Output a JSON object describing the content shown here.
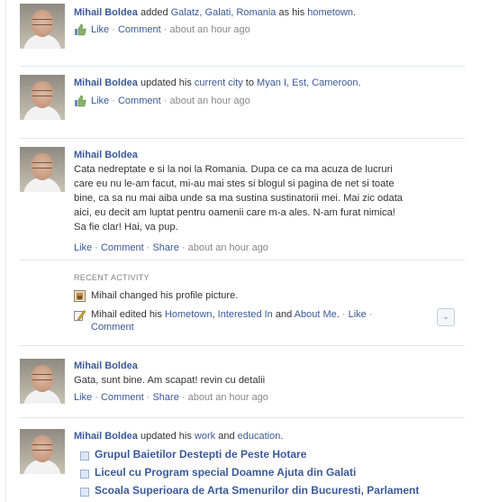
{
  "stories": {
    "s1": {
      "actor": "Mihail Boldea",
      "verb": "added",
      "place": "Galatz, Galati, Romania",
      "as_his": "as his",
      "target": "hometown",
      "end": ".",
      "like": "Like",
      "dot": "·",
      "comment": "Comment",
      "time": "about an hour ago"
    },
    "s2": {
      "actor": "Mihail Boldea",
      "updated_his": "updated his",
      "what": "current city",
      "to": "to",
      "place": "Myan I, Est, Cameroon",
      "end": ".",
      "like": "Like",
      "dot": "·",
      "comment": "Comment",
      "time": "about an hour ago"
    },
    "s3": {
      "actor": "Mihail Boldea",
      "lines": [
        "Cata nedreptate e si la noi la Romania. Dupa ce ca ma acuza de lucruri",
        "care eu nu le-am facut, mi-au mai stes si blogul si pagina de net si toate",
        "bine, ca sa nu mai aiba unde sa ma sustina sustinatorii mei. Mai zic odata",
        "aici, eu decit am luptat pentru oamenii care m-a ales. N-am furat nimica!",
        "Sa fie clar! Hai, va pup."
      ],
      "like": "Like",
      "dot": "·",
      "comment": "Comment",
      "share": "Share",
      "time": "about an hour ago"
    },
    "recent": {
      "heading": "RECENT ACTIVITY",
      "item1": "Mihail changed his profile picture.",
      "item2_pre": "Mihail edited his",
      "item2_a": "Hometown",
      "item2_comma": ",",
      "item2_b": "Interested In",
      "item2_and": "and",
      "item2_c": "About Me",
      "item2_end": ".",
      "dot": "·",
      "like": "Like",
      "comment": "Comment"
    },
    "s4": {
      "actor": "Mihail Boldea",
      "text": "Gata, sunt bine. Am scapat! revin cu detalii",
      "like": "Like",
      "dot": "·",
      "comment": "Comment",
      "share": "Share",
      "time": "about an hour ago"
    },
    "s5": {
      "actor": "Mihail Boldea",
      "updated_his": "updated his",
      "work": "work",
      "and": "and",
      "education": "education",
      "end": ".",
      "items": [
        "Grupul Baietilor Destepti de Peste Hotare",
        "Liceul cu Program special Doamne Ajuta din Galati",
        "Scoala Superioara de Arta Smenurilor din Bucuresti, Parlament"
      ]
    }
  },
  "colors": {
    "link": "#3b5998",
    "meta": "#888888",
    "separator": "#e4e7ee"
  },
  "icons": {
    "like": "thumbs-up-icon",
    "photo": "photo-icon",
    "edit": "pencil-icon",
    "menu": "chevron-down-icon",
    "bullet": "page-bullet-icon"
  }
}
